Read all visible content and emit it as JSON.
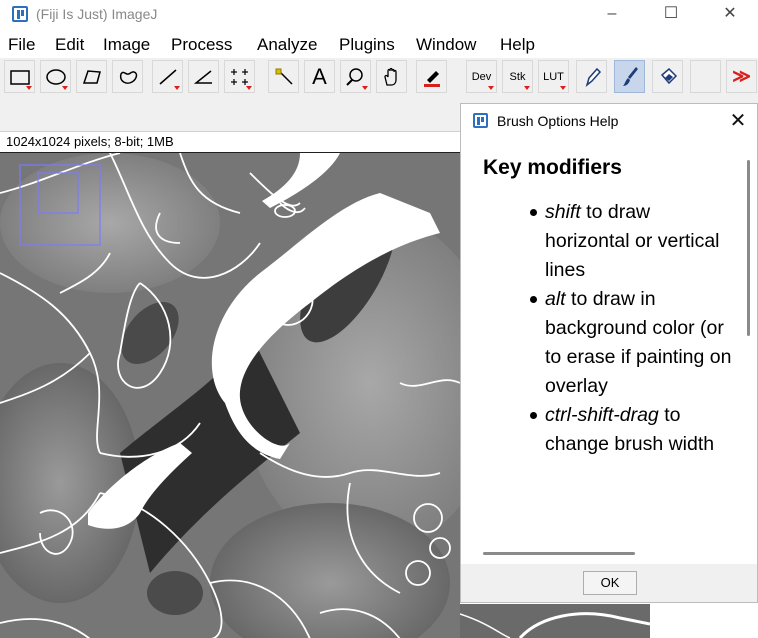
{
  "window": {
    "title": "(Fiji Is Just) ImageJ",
    "minimize": "–",
    "maximize": "☐",
    "close": "✕"
  },
  "menu": [
    "File",
    "Edit",
    "Image",
    "Process",
    "Analyze",
    "Plugins",
    "Window",
    "Help"
  ],
  "toolbar": {
    "dev": "Dev",
    "stk": "Stk",
    "lut": "LUT",
    "text_tool": "A",
    "more": "≫",
    "selected_tool": "brush-tool",
    "accent": "#d8201c"
  },
  "image_status": "1024x1024 pixels; 8-bit; 1MB",
  "dialog": {
    "title": "Brush Options Help",
    "close": "✕",
    "heading": "Key modifiers",
    "items": [
      {
        "key": "shift",
        "text": " to draw horizontal or vertical lines"
      },
      {
        "key": "alt",
        "text": " to draw in background color (or to erase if painting on overlay"
      },
      {
        "key": "ctrl-shift-drag",
        "text": " to change brush width"
      }
    ],
    "ok": "OK"
  }
}
